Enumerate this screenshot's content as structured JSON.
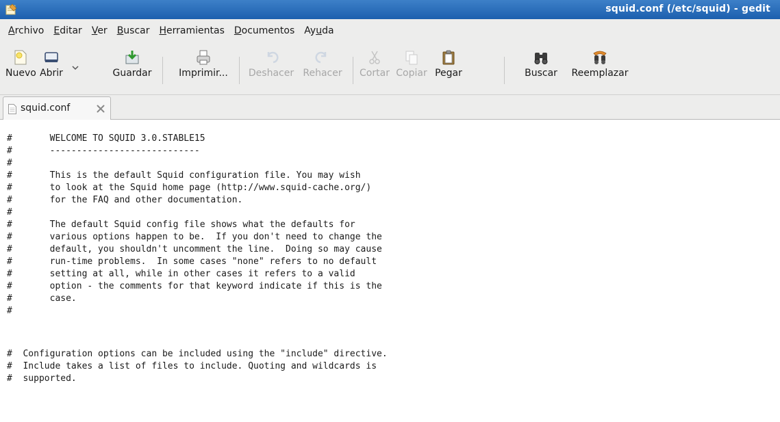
{
  "window": {
    "title": "squid.conf (/etc/squid) - gedit"
  },
  "menu": [
    {
      "label": "Archivo",
      "mnemonic_index": 0
    },
    {
      "label": "Editar",
      "mnemonic_index": 0
    },
    {
      "label": "Ver",
      "mnemonic_index": 0
    },
    {
      "label": "Buscar",
      "mnemonic_index": 0
    },
    {
      "label": "Herramientas",
      "mnemonic_index": 0
    },
    {
      "label": "Documentos",
      "mnemonic_index": 0
    },
    {
      "label": "Ayuda",
      "mnemonic_index": 2
    }
  ],
  "toolbar": {
    "new": {
      "label": "Nuevo",
      "icon": "new-document-icon"
    },
    "open": {
      "label": "Abrir",
      "icon": "open-folder-icon"
    },
    "open_dropdown": {
      "icon": "chevron-down-icon"
    },
    "save": {
      "label": "Guardar",
      "icon": "save-icon"
    },
    "print": {
      "label": "Imprimir...",
      "icon": "printer-icon"
    },
    "undo": {
      "label": "Deshacer",
      "icon": "undo-icon",
      "enabled": false
    },
    "redo": {
      "label": "Rehacer",
      "icon": "redo-icon",
      "enabled": false
    },
    "cut": {
      "label": "Cortar",
      "icon": "scissors-icon",
      "enabled": false
    },
    "copy": {
      "label": "Copiar",
      "icon": "copy-icon",
      "enabled": false
    },
    "paste": {
      "label": "Pegar",
      "icon": "clipboard-icon"
    },
    "find": {
      "label": "Buscar",
      "icon": "binoculars-icon"
    },
    "replace": {
      "label": "Reemplazar",
      "icon": "find-replace-icon"
    }
  },
  "tab": {
    "label": "squid.conf",
    "icon": "text-document-icon",
    "close_icon": "close-icon"
  },
  "editor": {
    "lines": [
      "#       WELCOME TO SQUID 3.0.STABLE15",
      "#       ----------------------------",
      "#",
      "#       This is the default Squid configuration file. You may wish",
      "#       to look at the Squid home page (http://www.squid-cache.org/)",
      "#       for the FAQ and other documentation.",
      "#",
      "#       The default Squid config file shows what the defaults for",
      "#       various options happen to be.  If you don't need to change the",
      "#       default, you shouldn't uncomment the line.  Doing so may cause",
      "#       run-time problems.  In some cases \"none\" refers to no default",
      "#       setting at all, while in other cases it refers to a valid",
      "#       option - the comments for that keyword indicate if this is the",
      "#       case.",
      "#",
      "",
      "",
      "#  Configuration options can be included using the \"include\" directive.",
      "#  Include takes a list of files to include. Quoting and wildcards is",
      "#  supported."
    ]
  },
  "colors": {
    "titlebar_top": "#3d80c8",
    "titlebar_bottom": "#1c5fae",
    "chrome": "#ededec",
    "disabled_text": "#a7a7a7"
  }
}
